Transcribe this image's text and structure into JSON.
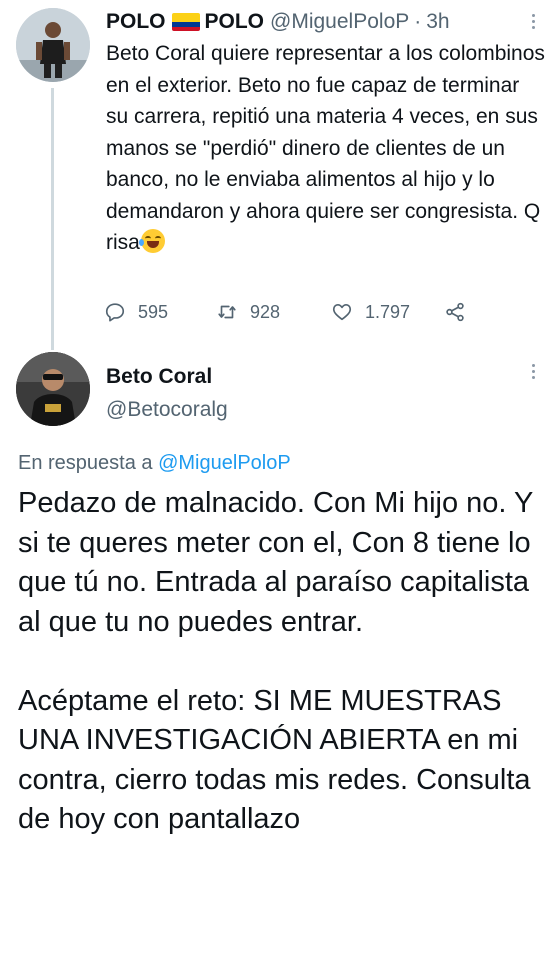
{
  "tweet1": {
    "name_left": "POLO",
    "name_right": "POLO",
    "handle": "@MiguelPoloP",
    "separator": "·",
    "time": "3h",
    "text": "Beto Coral quiere representar a los colombinos en el exterior. Beto no fue capaz de terminar su carrera, repitió una materia 4 veces, en sus manos se \"perdió\" dinero de clientes de un banco, no le enviaba alimentos al hijo y lo demandaron y ahora quiere ser congresista. Q risa",
    "emoji": "face-with-tears-of-joy",
    "counts": {
      "replies": "595",
      "retweets": "928",
      "likes": "1.797"
    }
  },
  "tweet2": {
    "name": "Beto Coral",
    "handle": "@Betocoralg",
    "reply_prefix": "En respuesta a",
    "reply_mention": "@MiguelPoloP",
    "paragraph1": "Pedazo de malnacido. Con Mi hijo no. Y si te queres meter con el, Con 8 tiene lo que tú no. Entrada al paraíso capitalista al que tu no puedes entrar.",
    "paragraph2": "Acéptame el reto: SI ME MUESTRAS UNA INVESTIGACIÓN ABIERTA en mi contra, cierro todas mis redes. Consulta de hoy con pantallazo"
  },
  "colors": {
    "text": "#0f1419",
    "secondary": "#536471",
    "link": "#1d9bf0",
    "thread_line": "#cfd9de"
  },
  "icons": [
    "reply-icon",
    "retweet-icon",
    "like-icon",
    "share-icon",
    "more-icon",
    "colombia-flag-icon"
  ]
}
